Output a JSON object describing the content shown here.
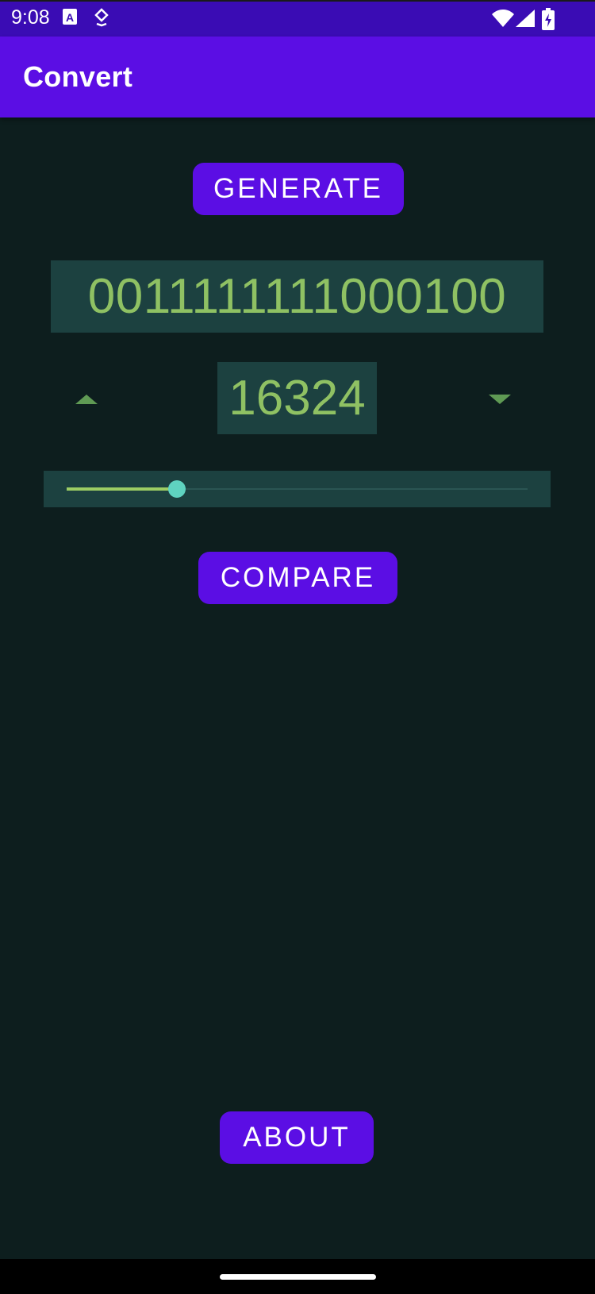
{
  "status_bar": {
    "time": "9:08",
    "icons": [
      "text-a-icon",
      "location-icon",
      "wifi-icon",
      "cell-signal-icon",
      "battery-charging-icon"
    ]
  },
  "app_bar": {
    "title": "Convert"
  },
  "main": {
    "generate_label": "GENERATE",
    "binary_value": "0011111111000100",
    "decimal_value": "16324",
    "slider_fraction": 0.24,
    "compare_label": "COMPARE",
    "about_label": "ABOUT"
  },
  "colors": {
    "primary": "#5b0ee4",
    "status_bar": "#3a0cb4",
    "background": "#0d1e1e",
    "field_bg": "#1c4140",
    "accent_text": "#8fc163",
    "slider_thumb": "#5fd3c0"
  }
}
